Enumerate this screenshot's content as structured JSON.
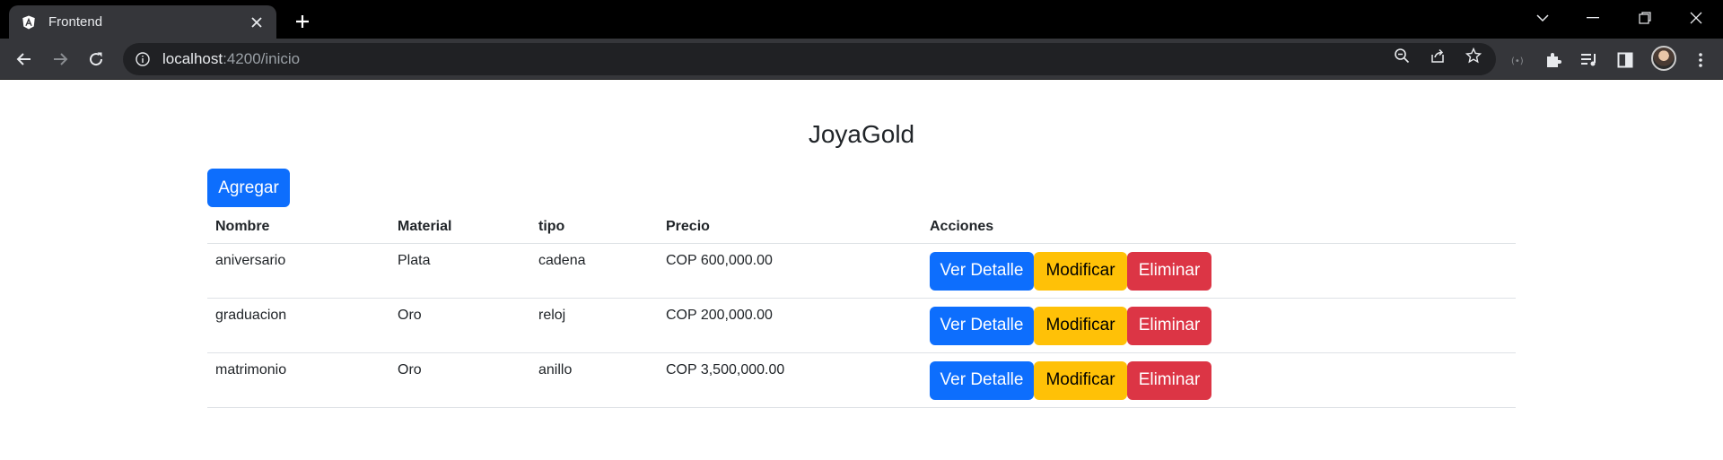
{
  "browser": {
    "tab_title": "Frontend",
    "url_host": "localhost",
    "url_path": ":4200/inicio"
  },
  "page": {
    "title": "JoyaGold",
    "add_button": "Agregar"
  },
  "table": {
    "headers": [
      "Nombre",
      "Material",
      "tipo",
      "Precio",
      "Acciones"
    ],
    "rows": [
      {
        "nombre": "aniversario",
        "material": "Plata",
        "tipo": "cadena",
        "precio": "COP 600,000.00"
      },
      {
        "nombre": "graduacion",
        "material": "Oro",
        "tipo": "reloj",
        "precio": "COP 200,000.00"
      },
      {
        "nombre": "matrimonio",
        "material": "Oro",
        "tipo": "anillo",
        "precio": "COP 3,500,000.00"
      }
    ],
    "actions": {
      "detail": "Ver Detalle",
      "modify": "Modificar",
      "delete": "Eliminar"
    }
  },
  "colors": {
    "primary": "#0d6efd",
    "warning": "#ffc107",
    "danger": "#dc3545"
  },
  "icons": [
    "angular-icon",
    "close-icon",
    "plus-icon",
    "chevron-down-icon",
    "minimize-icon",
    "restore-icon",
    "back-arrow-icon",
    "forward-arrow-icon",
    "reload-icon",
    "info-icon",
    "zoom-icon",
    "share-icon",
    "star-icon",
    "cast-icon",
    "puzzle-icon",
    "media-icon",
    "sidepanel-icon",
    "avatar",
    "menu-dots-icon"
  ]
}
